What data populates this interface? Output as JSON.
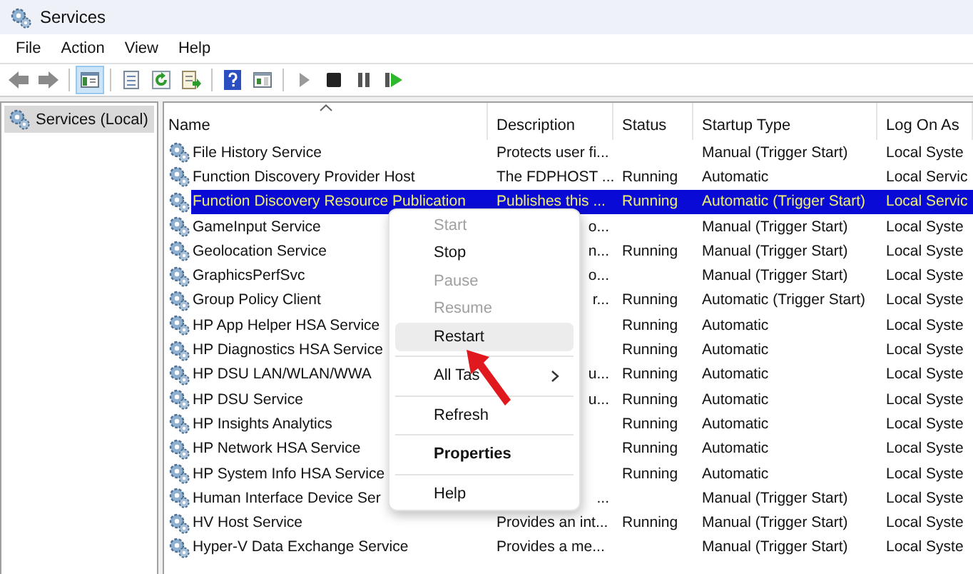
{
  "window": {
    "title": "Services"
  },
  "menu_bar": [
    "File",
    "Action",
    "View",
    "Help"
  ],
  "toolbar": {
    "groups": [
      [
        {
          "kind": "back",
          "on": false
        },
        {
          "kind": "forward",
          "on": false
        }
      ],
      [
        {
          "kind": "tree",
          "on": true
        }
      ],
      [
        {
          "kind": "properties",
          "on": false
        },
        {
          "kind": "refresh",
          "on": false
        },
        {
          "kind": "export",
          "on": false
        }
      ],
      [
        {
          "kind": "help",
          "on": false
        },
        {
          "kind": "console",
          "on": false
        }
      ],
      [
        {
          "kind": "play",
          "on": false
        },
        {
          "kind": "stop",
          "on": false
        },
        {
          "kind": "pause",
          "on": false
        },
        {
          "kind": "resume",
          "on": false
        }
      ]
    ]
  },
  "tree": {
    "items": [
      {
        "label": "Services (Local)",
        "selected": true
      }
    ]
  },
  "table": {
    "columns": [
      {
        "label": "Name",
        "sorted": true
      },
      {
        "label": "Description",
        "sorted": false
      },
      {
        "label": "Status",
        "sorted": false
      },
      {
        "label": "Startup Type",
        "sorted": false
      },
      {
        "label": "Log On As",
        "sorted": false
      }
    ],
    "rows": [
      {
        "name": "File History Service",
        "description": "Protects user fi...",
        "description_cut": false,
        "status": "",
        "startup_type": "Manual (Trigger Start)",
        "log_on_as": "Local Syste",
        "selected": false
      },
      {
        "name": "Function Discovery Provider Host",
        "description": "The FDPHOST ...",
        "description_cut": false,
        "status": "Running",
        "startup_type": "Automatic",
        "log_on_as": "Local Servic",
        "selected": false
      },
      {
        "name": "Function Discovery Resource Publication",
        "description": "Publishes this ...",
        "description_cut": false,
        "status": "Running",
        "startup_type": "Automatic (Trigger Start)",
        "log_on_as": "Local Servic",
        "selected": true
      },
      {
        "name": "GameInput Service",
        "description": "o...",
        "description_cut": true,
        "status": "",
        "startup_type": "Manual (Trigger Start)",
        "log_on_as": "Local Syste",
        "selected": false
      },
      {
        "name": "Geolocation Service",
        "description": "n...",
        "description_cut": true,
        "status": "Running",
        "startup_type": "Manual (Trigger Start)",
        "log_on_as": "Local Syste",
        "selected": false
      },
      {
        "name": "GraphicsPerfSvc",
        "description": "o...",
        "description_cut": true,
        "status": "",
        "startup_type": "Manual (Trigger Start)",
        "log_on_as": "Local Syste",
        "selected": false
      },
      {
        "name": "Group Policy Client",
        "description": "r...",
        "description_cut": true,
        "status": "Running",
        "startup_type": "Automatic (Trigger Start)",
        "log_on_as": "Local Syste",
        "selected": false
      },
      {
        "name": "HP App Helper HSA Service",
        "description": "",
        "status": "Running",
        "startup_type": "Automatic",
        "log_on_as": "Local Syste",
        "selected": false
      },
      {
        "name": "HP Diagnostics HSA Service",
        "description": "",
        "status": "Running",
        "startup_type": "Automatic",
        "log_on_as": "Local Syste",
        "selected": false
      },
      {
        "name": "HP DSU LAN/WLAN/WWA",
        "description": "u...",
        "description_cut": true,
        "status": "Running",
        "startup_type": "Automatic",
        "log_on_as": "Local Syste",
        "selected": false
      },
      {
        "name": "HP DSU Service",
        "description": "u...",
        "description_cut": true,
        "status": "Running",
        "startup_type": "Automatic",
        "log_on_as": "Local Syste",
        "selected": false
      },
      {
        "name": "HP Insights Analytics",
        "description": "",
        "status": "Running",
        "startup_type": "Automatic",
        "log_on_as": "Local Syste",
        "selected": false
      },
      {
        "name": "HP Network HSA Service",
        "description": "",
        "status": "Running",
        "startup_type": "Automatic",
        "log_on_as": "Local Syste",
        "selected": false
      },
      {
        "name": "HP System Info HSA Service",
        "description": "",
        "status": "Running",
        "startup_type": "Automatic",
        "log_on_as": "Local Syste",
        "selected": false
      },
      {
        "name": "Human Interface Device Ser",
        "description": "...",
        "description_cut": true,
        "status": "",
        "startup_type": "Manual (Trigger Start)",
        "log_on_as": "Local Syste",
        "selected": false
      },
      {
        "name": "HV Host Service",
        "description": "Provides an int...",
        "description_cut": false,
        "status": "Running",
        "startup_type": "Manual (Trigger Start)",
        "log_on_as": "Local Syste",
        "selected": false
      },
      {
        "name": "Hyper-V Data Exchange Service",
        "description": "Provides a me...",
        "description_cut": false,
        "status": "",
        "startup_type": "Manual (Trigger Start)",
        "log_on_as": "Local Syste",
        "selected": false
      }
    ]
  },
  "context_menu": {
    "items": [
      {
        "kind": "item",
        "label": "Start",
        "disabled": true,
        "hovered": false,
        "default": false,
        "submenu": false
      },
      {
        "kind": "item",
        "label": "Stop",
        "disabled": false,
        "hovered": false,
        "default": false,
        "submenu": false
      },
      {
        "kind": "item",
        "label": "Pause",
        "disabled": true,
        "hovered": false,
        "default": false,
        "submenu": false
      },
      {
        "kind": "item",
        "label": "Resume",
        "disabled": true,
        "hovered": false,
        "default": false,
        "submenu": false
      },
      {
        "kind": "item",
        "label": "Restart",
        "disabled": false,
        "hovered": true,
        "default": false,
        "submenu": false
      },
      {
        "kind": "separator"
      },
      {
        "kind": "item",
        "label": "All Tas",
        "disabled": false,
        "hovered": false,
        "default": false,
        "submenu": true
      },
      {
        "kind": "separator"
      },
      {
        "kind": "item",
        "label": "Refresh",
        "disabled": false,
        "hovered": false,
        "default": false,
        "submenu": false
      },
      {
        "kind": "separator"
      },
      {
        "kind": "item",
        "label": "Properties",
        "disabled": false,
        "hovered": false,
        "default": true,
        "submenu": false
      },
      {
        "kind": "separator"
      },
      {
        "kind": "item",
        "label": "Help",
        "disabled": false,
        "hovered": false,
        "default": false,
        "submenu": false
      }
    ]
  }
}
